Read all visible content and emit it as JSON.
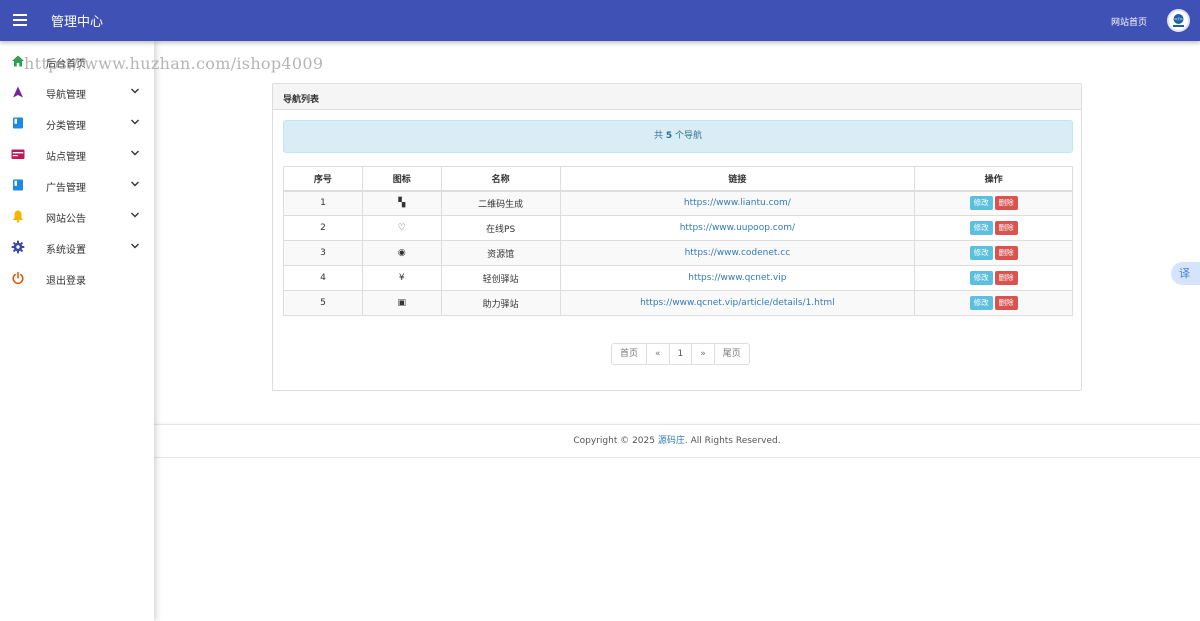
{
  "header": {
    "title": "管理中心",
    "home_link": "网站首页",
    "bar_color": "#3f51b5"
  },
  "watermark": "https://www.huzhan.com/ishop4009",
  "sidebar": {
    "items": [
      {
        "label": "后台首页",
        "icon": "home-icon",
        "color": "#2e9e4f",
        "has_submenu": false
      },
      {
        "label": "导航管理",
        "icon": "navigation-arrow-icon",
        "color": "#7b1fa2",
        "has_submenu": true
      },
      {
        "label": "分类管理",
        "icon": "book-icon",
        "color": "#1e88e5",
        "has_submenu": true
      },
      {
        "label": "站点管理",
        "icon": "card-icon",
        "color": "#c2185b",
        "has_submenu": true
      },
      {
        "label": "广告管理",
        "icon": "book-icon",
        "color": "#1e88e5",
        "has_submenu": true
      },
      {
        "label": "网站公告",
        "icon": "bell-icon",
        "color": "#f4b400",
        "has_submenu": true
      },
      {
        "label": "系统设置",
        "icon": "gear-icon",
        "color": "#3949ab",
        "has_submenu": true
      },
      {
        "label": "退出登录",
        "icon": "power-icon",
        "color": "#e65100",
        "has_submenu": false
      }
    ]
  },
  "panel": {
    "title": "导航列表",
    "alert": {
      "prefix": "共 ",
      "count": "5",
      "suffix": " 个导航"
    },
    "columns": [
      "序号",
      "图标",
      "名称",
      "链接",
      "操作"
    ],
    "rows": [
      {
        "no": "1",
        "icon": "qrcode-icon",
        "glyph": "▚",
        "name": "二维码生成",
        "link": "https://www.liantu.com/"
      },
      {
        "no": "2",
        "icon": "heart-icon",
        "glyph": "♡",
        "name": "在线PS",
        "link": "https://www.uupoop.com/"
      },
      {
        "no": "3",
        "icon": "chrome-icon",
        "glyph": "◉",
        "name": "资源馆",
        "link": "https://www.codenet.cc"
      },
      {
        "no": "4",
        "icon": "yen-icon",
        "glyph": "¥",
        "name": "轻创驿站",
        "link": "https://www.qcnet.vip"
      },
      {
        "no": "5",
        "icon": "store-icon",
        "glyph": "▣",
        "name": "助力驿站",
        "link": "https://www.qcnet.vip/article/details/1.html"
      }
    ],
    "actions": {
      "edit": "修改",
      "delete": "删除"
    },
    "pager": {
      "first": "首页",
      "prev": "«",
      "current": "1",
      "next": "»",
      "last": "尾页"
    }
  },
  "footer": {
    "prefix": "Copyright © 2025 ",
    "brand": "源码庄",
    "suffix": ". All Rights Reserved."
  },
  "translate_button": "译"
}
